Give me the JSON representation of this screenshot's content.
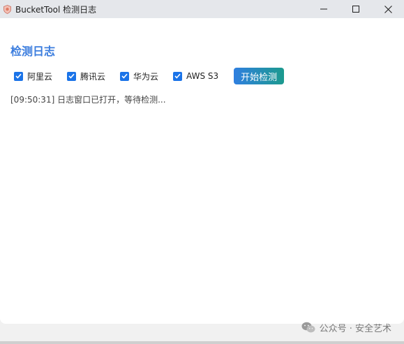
{
  "window": {
    "title": "BucketTool 检测日志"
  },
  "main": {
    "heading": "检测日志",
    "providers": [
      {
        "label": "阿里云",
        "checked": true
      },
      {
        "label": "腾讯云",
        "checked": true
      },
      {
        "label": "华为云",
        "checked": true
      },
      {
        "label": "AWS S3",
        "checked": true
      }
    ],
    "start_button": "开始检测",
    "log_line": "[09:50:31] 日志窗口已打开，等待检测..."
  },
  "watermark": {
    "text": "公众号 · 安全艺术"
  },
  "colors": {
    "accent": "#3b7dde",
    "checkbox": "#1a73e8"
  }
}
